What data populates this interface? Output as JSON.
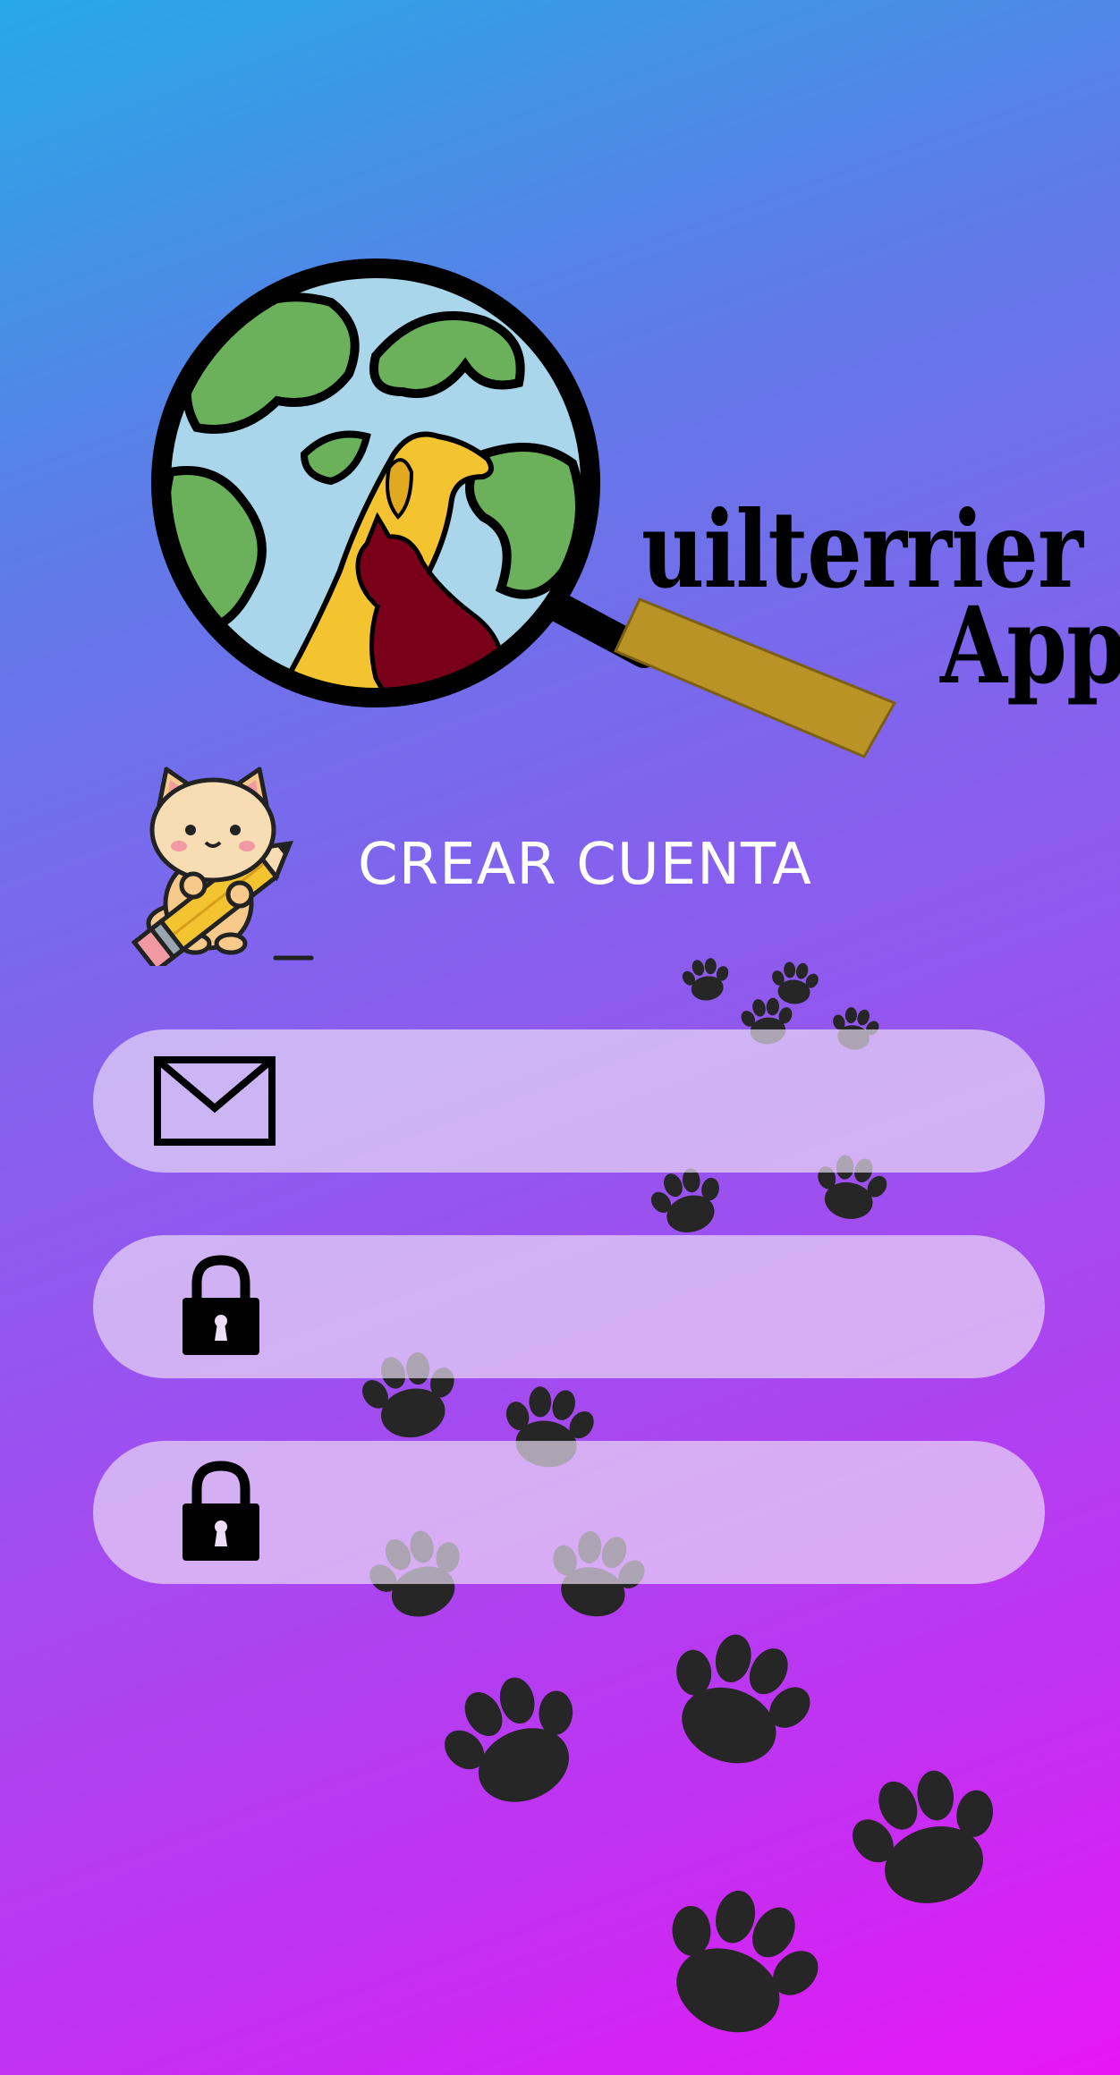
{
  "app": {
    "logo_line1": "uilterrier",
    "logo_line2": "App"
  },
  "page": {
    "title": "CREAR CUENTA"
  },
  "form": {
    "email": {
      "value": "",
      "placeholder": "",
      "icon": "mail-icon"
    },
    "password": {
      "value": "",
      "placeholder": "",
      "icon": "lock-icon"
    },
    "confirm_password": {
      "value": "",
      "placeholder": "",
      "icon": "lock-icon"
    }
  },
  "colors": {
    "gradient_top": "#27a9e6",
    "gradient_bottom": "#e716f7",
    "field_background": "#ecdef6",
    "title_text": "#ffffff",
    "logo_handle": "#b99325"
  }
}
